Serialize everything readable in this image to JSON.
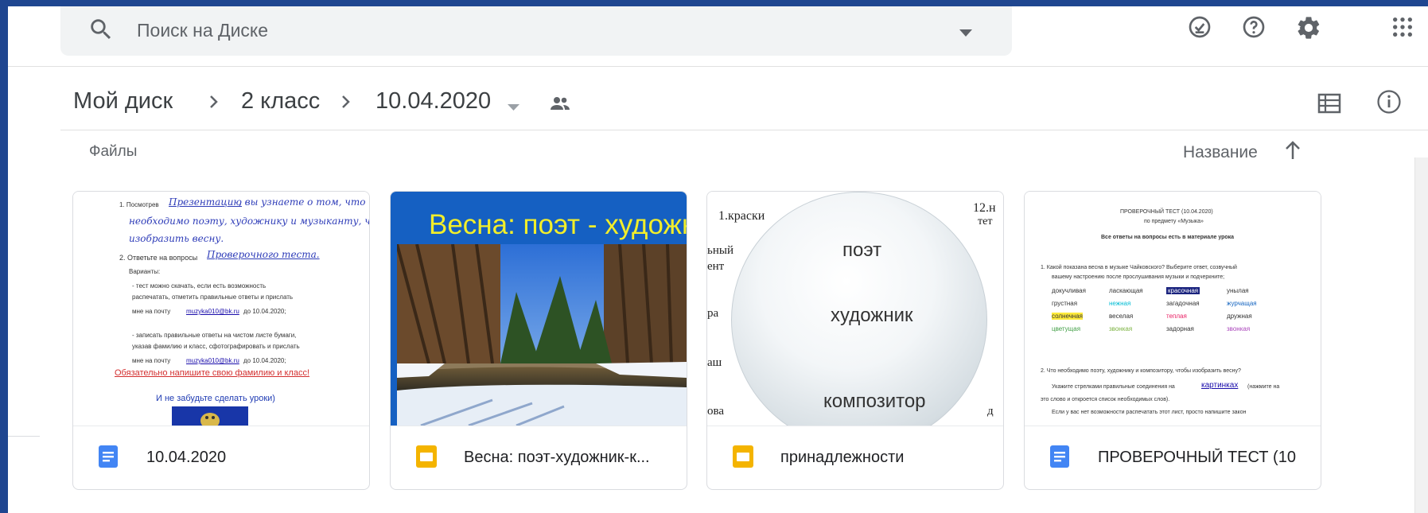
{
  "search": {
    "placeholder": "Поиск на Диске"
  },
  "breadcrumb": {
    "root": "Мой диск",
    "parent": "2 класс",
    "current": "10.04.2020"
  },
  "list_header": {
    "files_label": "Файлы",
    "sort_label": "Название"
  },
  "files": [
    {
      "name": "10.04.2020",
      "type_icon": "google-docs-icon",
      "preview": {
        "line1": "1. Посмотрев",
        "line1_link": "Презентацию",
        "line1_tail": ", вы узнаете о том, что",
        "line2": "необходимо поэту, художнику и музыканту, чтобы",
        "line3": "изобразить весну.",
        "line4": "2. Ответьте на вопросы",
        "line4_link": "Проверочного теста.",
        "line5": "Варианты:",
        "line6": "- тест можно скачать, если есть возможность",
        "line7": "распечатать, отметить правильные ответы и прислать",
        "line8": "мне на почту",
        "line8_link": "muzyka010@bk.ru",
        "line8_tail": "до 10.04.2020;",
        "line9": "- записать правильные ответы на чистом листе бумаги,",
        "line10": "указав фамилию и класс, сфотографировать и прислать",
        "line11": "мне на почту",
        "line11_link": "muzyka010@bk.ru",
        "line11_tail": "до 10.04.2020;",
        "red_line": "Обязательно напишите свою фамилию и класс!",
        "blue_line": "И не забудьте сделать уроки)"
      }
    },
    {
      "name": "Весна: поэт-художник-к...",
      "type_icon": "google-slides-icon",
      "preview": {
        "title": "Весна: поэт - художни"
      }
    },
    {
      "name": "принадлежности",
      "type_icon": "google-slides-icon",
      "preview": {
        "top_left": "1.краски",
        "top_right": "12.н",
        "top_right2": "тет",
        "left1": "ьный",
        "left2": "ент",
        "left3": "ра",
        "left4": "аш",
        "left5": "ова",
        "right_bottom": "д",
        "word1": "поэт",
        "word2": "художник",
        "word3": "композитор"
      }
    },
    {
      "name": "ПРОВЕРОЧНЫЙ ТЕСТ (10",
      "type_icon": "google-docs-icon",
      "preview": {
        "title1": "ПРОВЕРОЧНЫЙ ТЕСТ (10.04.2020)",
        "title2": "по предмету «Музыка»",
        "subtitle": "Все ответы на вопросы есть в материале урока",
        "q1": "1. Какой показана весна в музыке Чайковского? Выберите ответ, созвучный",
        "q1b": "вашему настроению после прослушивания музыки и подчеркните;",
        "w": [
          "докучливая",
          "ласкающая",
          "красочная",
          "унылая",
          "грустная",
          "нежная",
          "загадочная",
          "журчащая",
          "солнечная",
          "веселая",
          "теплая",
          "дружная",
          "цветущая",
          "звонкая",
          "задорная",
          "звонкая"
        ],
        "q2": "2. Что необходимо поэту, художнику и композитору, чтобы изобразить весну?",
        "q2b": "Укажите стрелками правильные соединения на",
        "q2link": "картинках",
        "q2c": "(нажмите на",
        "q2d": "это слово и откроется список необходимых слов).",
        "q2e": "Если у вас нет возможности распечатать этот лист, просто напишите  закон"
      }
    }
  ],
  "colors": {
    "accent_blue": "#1a73e8",
    "docs_blue": "#4285f4",
    "slides_yellow": "#f4b400",
    "frame_border": "#1f4690"
  }
}
